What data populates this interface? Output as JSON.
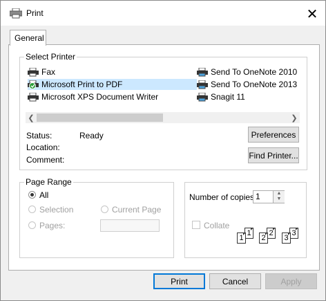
{
  "window": {
    "title": "Print",
    "close_glyph": "✕"
  },
  "tabs": [
    {
      "label": "General"
    }
  ],
  "select_printer": {
    "group_label": "Select Printer",
    "printers_left": [
      "Fax",
      "Microsoft Print to PDF",
      "Microsoft XPS Document Writer"
    ],
    "printers_right": [
      "Send To OneNote 2010",
      "Send To OneNote 2013",
      "Snagit 11"
    ],
    "selected": "Microsoft Print to PDF",
    "status_label": "Status:",
    "status_value": "Ready",
    "location_label": "Location:",
    "comment_label": "Comment:",
    "preferences_button": "Preferences",
    "find_printer_button": "Find Printer..."
  },
  "page_range": {
    "group_label": "Page Range",
    "all_label": "All",
    "selection_label": "Selection",
    "current_page_label": "Current Page",
    "pages_label": "Pages:",
    "pages_value": ""
  },
  "copies": {
    "number_label": "Number of copies:",
    "number_value": "1",
    "collate_label": "Collate",
    "collate_pages": [
      "1",
      "1",
      "2",
      "2",
      "3",
      "3"
    ]
  },
  "footer": {
    "print_button": "Print",
    "cancel_button": "Cancel",
    "apply_button": "Apply"
  },
  "colors": {
    "selection_bg": "#cce8ff",
    "focus_border": "#0078d7",
    "disabled_text": "#a0a0a0"
  }
}
